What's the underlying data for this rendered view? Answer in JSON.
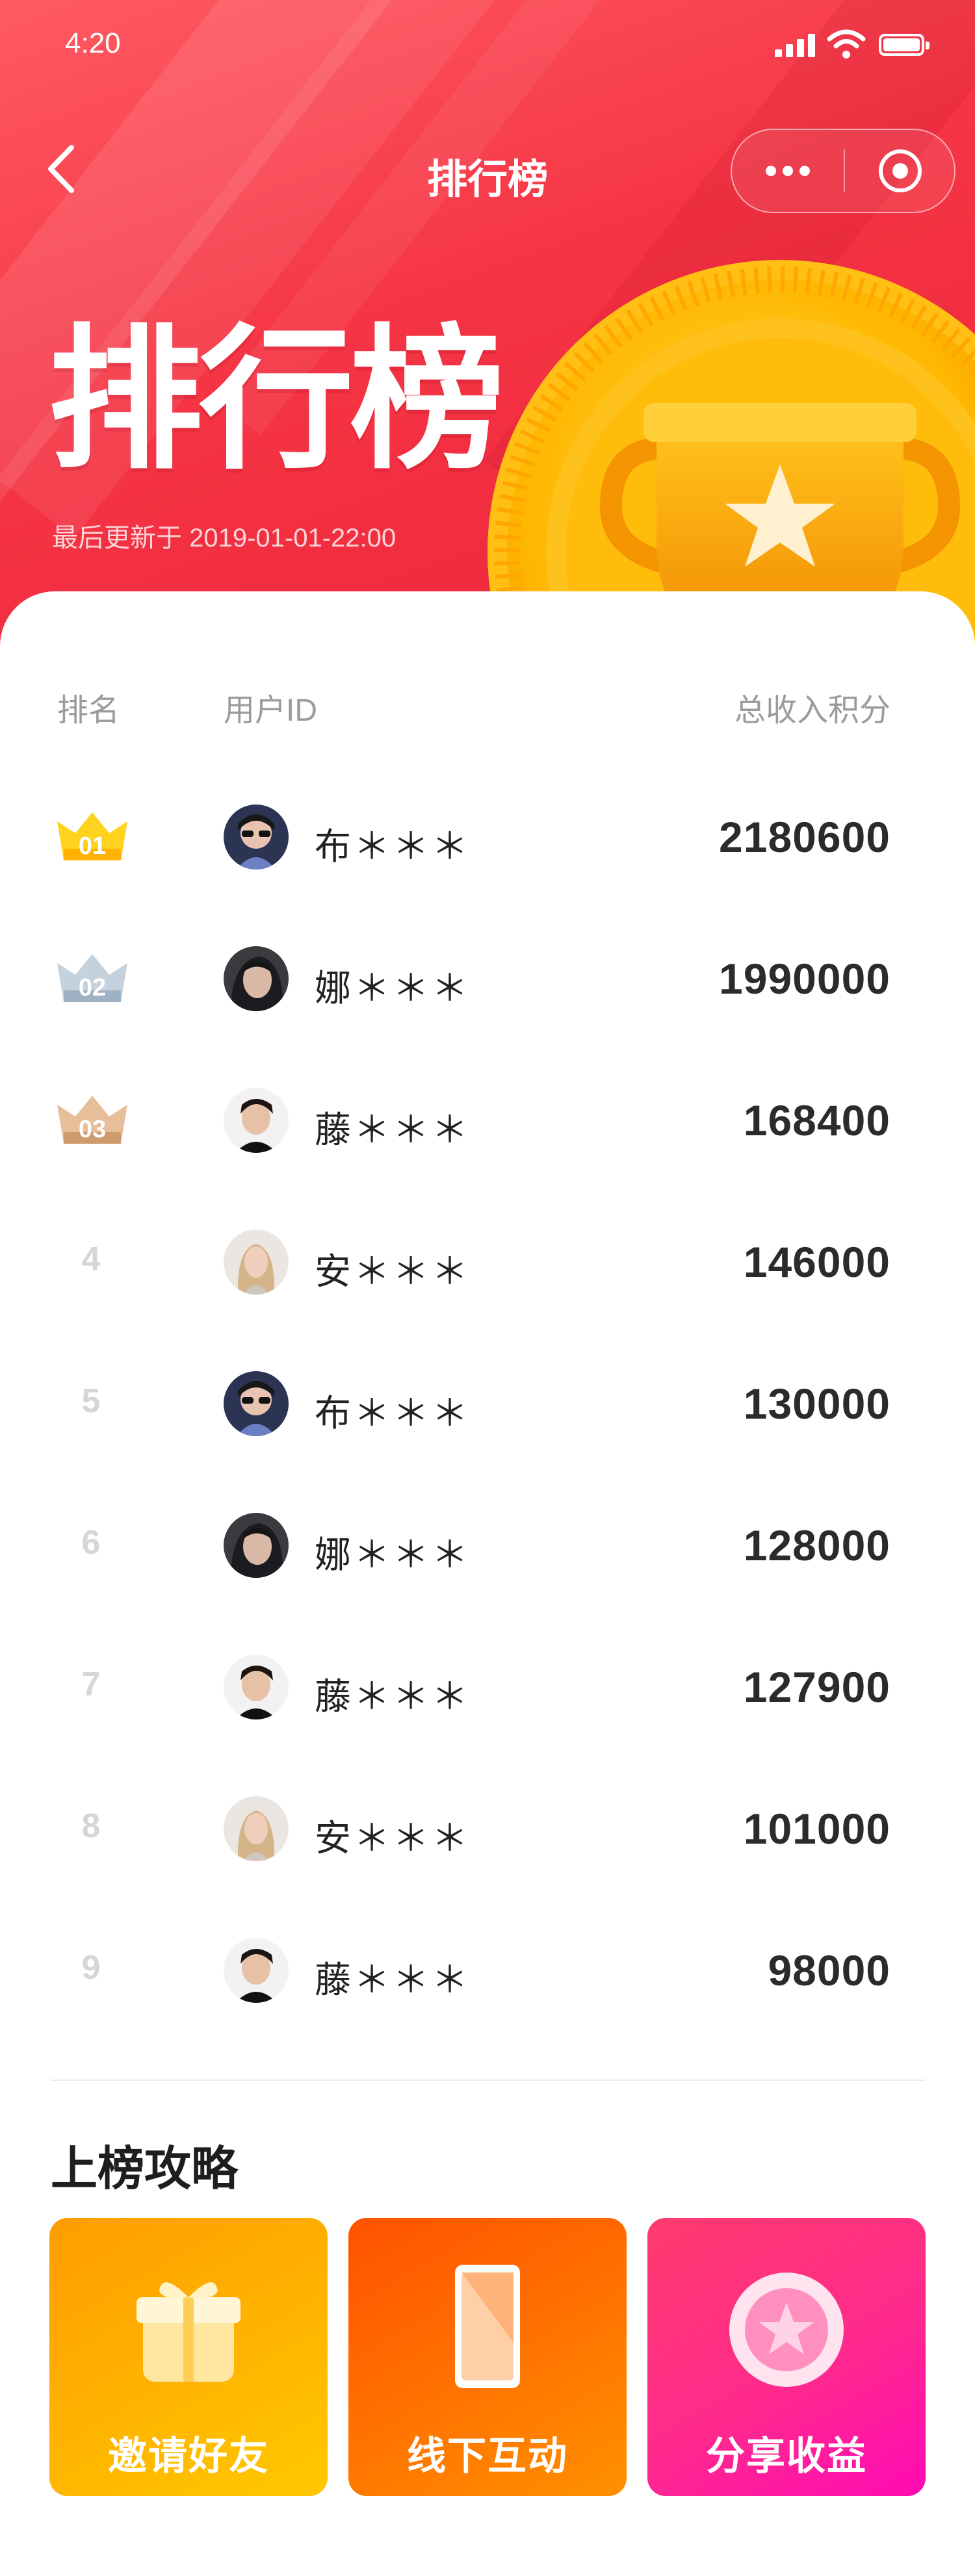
{
  "status_bar": {
    "time": "4:20"
  },
  "nav": {
    "title": "排行榜"
  },
  "hero": {
    "title": "排行榜",
    "updated": "最后更新于 2019-01-01-22:00"
  },
  "table": {
    "headers": {
      "rank": "排名",
      "user": "用户ID",
      "score": "总收入积分"
    },
    "rows": [
      {
        "rank": "01",
        "name": "布＊＊＊",
        "score": "2180600",
        "medal": "gold",
        "avatar": "avatar-bu"
      },
      {
        "rank": "02",
        "name": "娜＊＊＊",
        "score": "1990000",
        "medal": "silver",
        "avatar": "avatar-na"
      },
      {
        "rank": "03",
        "name": "藤＊＊＊",
        "score": "168400",
        "medal": "bronze",
        "avatar": "avatar-teng"
      },
      {
        "rank": "4",
        "name": "安＊＊＊",
        "score": "146000",
        "medal": "",
        "avatar": "avatar-an"
      },
      {
        "rank": "5",
        "name": "布＊＊＊",
        "score": "130000",
        "medal": "",
        "avatar": "avatar-bu"
      },
      {
        "rank": "6",
        "name": "娜＊＊＊",
        "score": "128000",
        "medal": "",
        "avatar": "avatar-na"
      },
      {
        "rank": "7",
        "name": "藤＊＊＊",
        "score": "127900",
        "medal": "",
        "avatar": "avatar-teng"
      },
      {
        "rank": "8",
        "name": "安＊＊＊",
        "score": "101000",
        "medal": "",
        "avatar": "avatar-an"
      },
      {
        "rank": "9",
        "name": "藤＊＊＊",
        "score": "98000",
        "medal": "",
        "avatar": "avatar-teng"
      }
    ]
  },
  "strategy": {
    "title": "上榜攻略",
    "tiles": [
      {
        "label": "邀请好友",
        "icon": "gift-icon"
      },
      {
        "label": "线下互动",
        "icon": "phone-icon"
      },
      {
        "label": "分享收益",
        "icon": "star-coin-icon"
      }
    ]
  },
  "colors": {
    "header_red": "#f53545",
    "gold": "#ffc400",
    "silver": "#a9bccd",
    "bronze": "#d9a97d",
    "rank_grey": "#d6d6d6",
    "tile_orange": "#ffb400",
    "tile_red_orange": "#ff6a00",
    "tile_pink": "#ff2a8c"
  }
}
